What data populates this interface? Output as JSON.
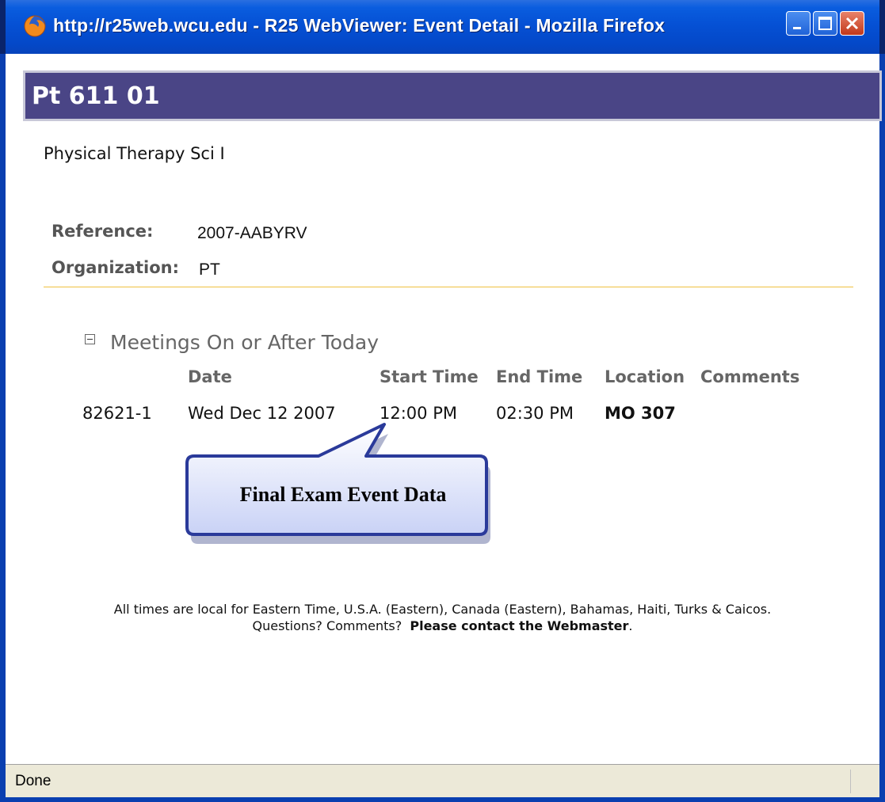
{
  "window": {
    "title": "http://r25web.wcu.edu - R25 WebViewer: Event Detail - Mozilla Firefox"
  },
  "event": {
    "title": "Pt 611 01",
    "subtitle": "Physical Therapy Sci I",
    "reference_label": "Reference:",
    "reference_value": "2007-AABYRV",
    "organization_label": "Organization:",
    "organization_value": "PT"
  },
  "meetings": {
    "section_title": "Meetings On or After Today",
    "columns": [
      "Date",
      "Start Time",
      "End Time",
      "Location",
      "Comments"
    ],
    "rows": [
      {
        "id": "82621-1",
        "date": "Wed Dec 12 2007",
        "start": "12:00 PM",
        "end": "02:30 PM",
        "location": "MO 307",
        "comments": ""
      }
    ]
  },
  "callout": {
    "text": "Final Exam Event Data"
  },
  "footer": {
    "line1": "All times are local for Eastern Time, U.S.A. (Eastern), Canada (Eastern), Bahamas, Haiti, Turks & Caicos.",
    "line2_prefix": "Questions? Comments?",
    "contact_link": "Please contact the Webmaster",
    "line2_suffix": "."
  },
  "status": {
    "text": "Done"
  },
  "colors": {
    "header_bg": "#4a4586",
    "divider": "#f0c040",
    "callout_fill": "#e8ecff",
    "callout_border": "#2a3a9a"
  },
  "icons": [
    "firefox-icon",
    "minimize-icon",
    "maximize-icon",
    "close-icon",
    "collapse-icon"
  ]
}
